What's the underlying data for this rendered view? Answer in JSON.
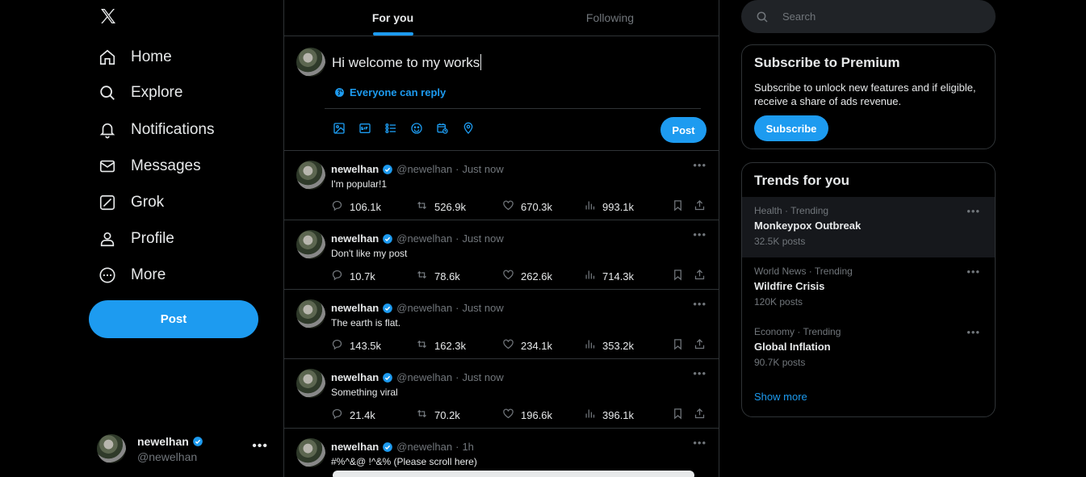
{
  "nav": {
    "items": [
      {
        "label": "Home",
        "icon": "home-icon"
      },
      {
        "label": "Explore",
        "icon": "search-icon"
      },
      {
        "label": "Notifications",
        "icon": "bell-icon"
      },
      {
        "label": "Messages",
        "icon": "mail-icon"
      },
      {
        "label": "Grok",
        "icon": "grok-icon"
      },
      {
        "label": "Profile",
        "icon": "person-icon"
      },
      {
        "label": "More",
        "icon": "more-circle-icon"
      }
    ],
    "post_label": "Post"
  },
  "account": {
    "name": "newelhan",
    "handle": "@newelhan"
  },
  "tabs": [
    {
      "label": "For you",
      "active": true
    },
    {
      "label": "Following",
      "active": false
    }
  ],
  "composer": {
    "text": "Hi welcome to my works",
    "reply_setting": "Everyone can reply",
    "post_label": "Post"
  },
  "tweets": [
    {
      "author": "newelhan",
      "handle": "@newelhan",
      "time": "Just now",
      "text": "I'm popular!1",
      "replies": "106.1k",
      "reposts": "526.9k",
      "likes": "670.3k",
      "views": "993.1k"
    },
    {
      "author": "newelhan",
      "handle": "@newelhan",
      "time": "Just now",
      "text": "Don't like my post",
      "replies": "10.7k",
      "reposts": "78.6k",
      "likes": "262.6k",
      "views": "714.3k"
    },
    {
      "author": "newelhan",
      "handle": "@newelhan",
      "time": "Just now",
      "text": "The earth is flat.",
      "replies": "143.5k",
      "reposts": "162.3k",
      "likes": "234.1k",
      "views": "353.2k"
    },
    {
      "author": "newelhan",
      "handle": "@newelhan",
      "time": "Just now",
      "text": "Something viral",
      "replies": "21.4k",
      "reposts": "70.2k",
      "likes": "196.6k",
      "views": "396.1k"
    },
    {
      "author": "newelhan",
      "handle": "@newelhan",
      "time": "1h",
      "text": "#%^&@ !^&% (Please scroll here)",
      "replies": "",
      "reposts": "",
      "likes": "",
      "views": ""
    }
  ],
  "search": {
    "placeholder": "Search"
  },
  "premium": {
    "title": "Subscribe to Premium",
    "text": "Subscribe to unlock new features and if eligible, receive a share of ads revenue.",
    "button": "Subscribe"
  },
  "trends": {
    "title": "Trends for you",
    "items": [
      {
        "meta": "Health · Trending",
        "topic": "Monkeypox Outbreak",
        "count": "32.5K posts"
      },
      {
        "meta": "World News · Trending",
        "topic": "Wildfire Crisis",
        "count": "120K posts"
      },
      {
        "meta": "Economy · Trending",
        "topic": "Global Inflation",
        "count": "90.7K posts"
      }
    ],
    "show_more": "Show more"
  },
  "colors": {
    "accent": "#1d9bf0",
    "background": "#000000",
    "border": "#2f3336",
    "muted": "#71767b"
  }
}
